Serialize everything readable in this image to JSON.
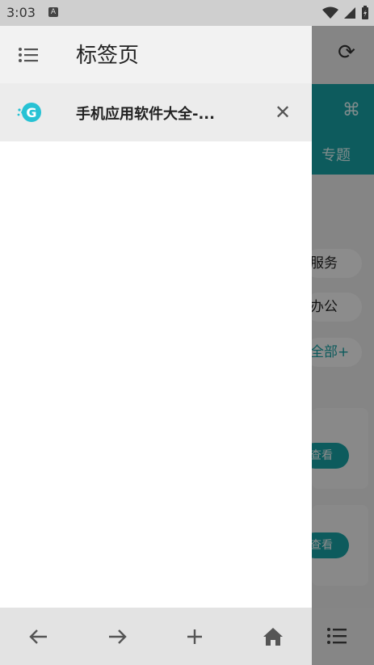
{
  "status_bar": {
    "time": "3:03",
    "notification_icon": "A"
  },
  "drawer": {
    "menu_icon": "list-icon",
    "title": "标签页",
    "tabs": [
      {
        "title": "手机应用软件大全-...",
        "favicon": "app-logo-icon",
        "close_icon": "close-icon"
      }
    ],
    "bottom_nav": [
      {
        "name": "back",
        "icon": "arrow-left-icon"
      },
      {
        "name": "forward",
        "icon": "arrow-right-icon"
      },
      {
        "name": "new-tab",
        "icon": "plus-icon"
      },
      {
        "name": "home",
        "icon": "home-icon"
      }
    ]
  },
  "background_page": {
    "reload_icon": "reload-icon",
    "topic_label": "专题",
    "pills": [
      "服务",
      "办公",
      "全部+"
    ],
    "view_buttons": [
      "查看",
      "查看"
    ],
    "menu_icon": "list-icon"
  },
  "colors": {
    "accent": "#18a6a9",
    "drawer_header": "#f2f2f2",
    "selected_tab": "#ececec",
    "bottom_bar": "#e3e3e3"
  }
}
